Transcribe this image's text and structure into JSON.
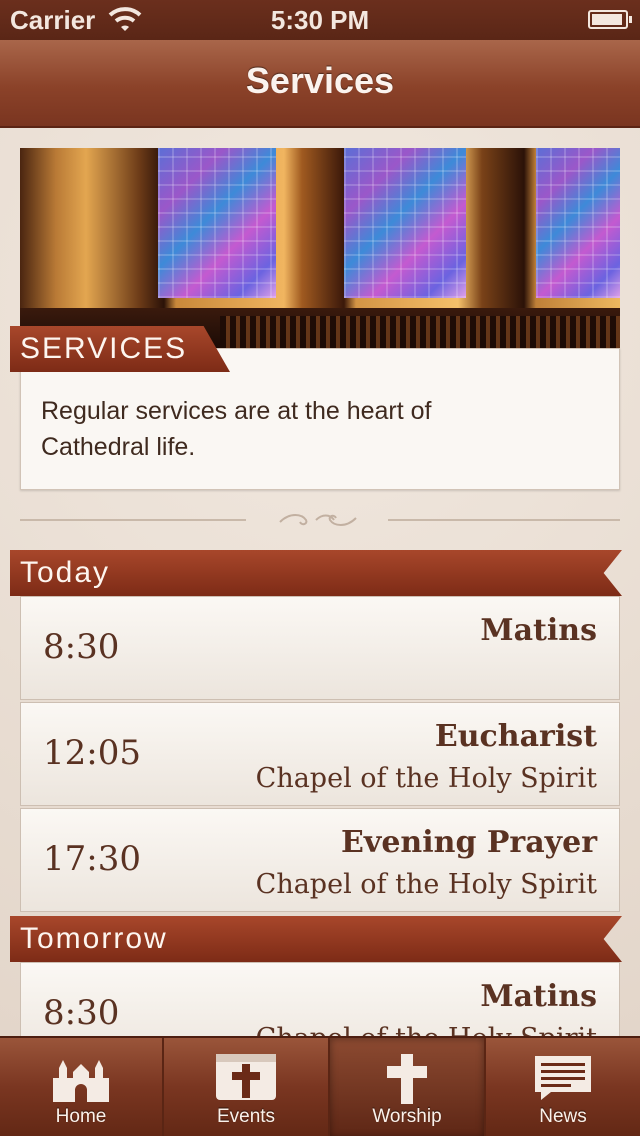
{
  "status_bar": {
    "carrier": "Carrier",
    "time": "5:30 PM"
  },
  "nav": {
    "title": "Services"
  },
  "intro": {
    "heading": "SERVICES",
    "description": "Regular services are at the heart of Cathedral life."
  },
  "sections": [
    {
      "heading": "Today",
      "services": [
        {
          "time": "8:30",
          "name": "Matins",
          "place": ""
        },
        {
          "time": "12:05",
          "name": "Eucharist",
          "place": "Chapel of the Holy Spirit"
        },
        {
          "time": "17:30",
          "name": "Evening Prayer",
          "place": "Chapel of the Holy Spirit"
        }
      ]
    },
    {
      "heading": "Tomorrow",
      "services": [
        {
          "time": "8:30",
          "name": "Matins",
          "place": "Chapel of the Holy Spirit"
        }
      ]
    }
  ],
  "tabs": [
    {
      "label": "Home",
      "icon": "cathedral-icon"
    },
    {
      "label": "Events",
      "icon": "calendar-cross-icon"
    },
    {
      "label": "Worship",
      "icon": "cross-icon",
      "selected": true
    },
    {
      "label": "News",
      "icon": "newspaper-icon"
    }
  ],
  "colors": {
    "accent": "#8b3a22",
    "text": "#5a3222",
    "background": "#e9ded4"
  }
}
